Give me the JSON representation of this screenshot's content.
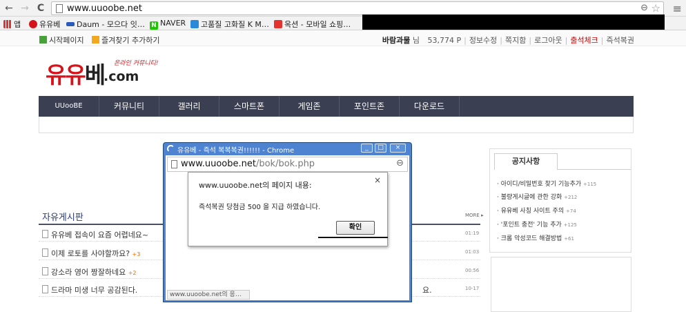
{
  "browser": {
    "url": "www.uuoobe.net",
    "bookmarks": [
      "앱",
      "유유베",
      "Daum - 모으다 잇…",
      "NAVER",
      "고품질 고화질 K M…",
      "옥션 - 모바일 쇼핑…"
    ],
    "colors": {
      "naver": "#1ec800",
      "daum": "#2c5ab8",
      "auction": "#e4322c",
      "kmplayer": "#2a88d8"
    }
  },
  "site_top": {
    "start_page": "시작페이지",
    "add_favorite": "즐겨찾기 추가하기",
    "user_name": "바람과물",
    "user_suffix": "님",
    "points": "53,774 P",
    "links": [
      "정보수정",
      "쪽지함",
      "로그아웃"
    ],
    "attendance": "출석체크",
    "last_link": "즉석복권"
  },
  "logo": {
    "red": "유유",
    "dark": "베",
    "dotcom": ".com",
    "script": "온라인 커뮤니티!"
  },
  "nav": [
    "UUooBE",
    "커뮤니티",
    "갤러리",
    "스마트폰",
    "게임존",
    "포인트존",
    "다운로드"
  ],
  "board": {
    "title": "자유게시판",
    "more": "MORE",
    "rows": [
      {
        "title": "유유베 접속이 요즘 어렵네요~",
        "count": "",
        "time": "01:19",
        "extra": ""
      },
      {
        "title": "이제 로토를 사야할까요?",
        "count": "+3",
        "time": "01:03",
        "extra": ""
      },
      {
        "title": "강소라 영어 짱잘하네요",
        "count": "+2",
        "time": "00:56",
        "extra": ""
      },
      {
        "title": "드라마 미생 너무 공감된다.",
        "count": "",
        "time": "10-17",
        "extra": "요."
      }
    ]
  },
  "notice": {
    "tab": "공지사항",
    "items": [
      {
        "text": "아이디/비밀번호 찾기 기능추가",
        "count": "+115"
      },
      {
        "text": "불량게시글에 관한 강화",
        "count": "+212"
      },
      {
        "text": "유유베 사칭 사이트 주의",
        "count": "+74"
      },
      {
        "text": "'포인트 충전' 기능 추가",
        "count": "+125"
      },
      {
        "text": "크롬 악성코드 해결방법",
        "count": "+61"
      }
    ]
  },
  "popup": {
    "title": "유유베 - 즉석 복복복권!!!!!! - Chrome",
    "url_domain": "www.uuoobe.net",
    "url_path": "/bok/bok.php",
    "status": "www.uuoobe.net의 응…"
  },
  "dialog": {
    "title": "www.uuoobe.net의 페이지 내용:",
    "message": "즉석복권 당첨금 500 을 지급 하였습니다.",
    "ok": "확인",
    "close": "×"
  }
}
